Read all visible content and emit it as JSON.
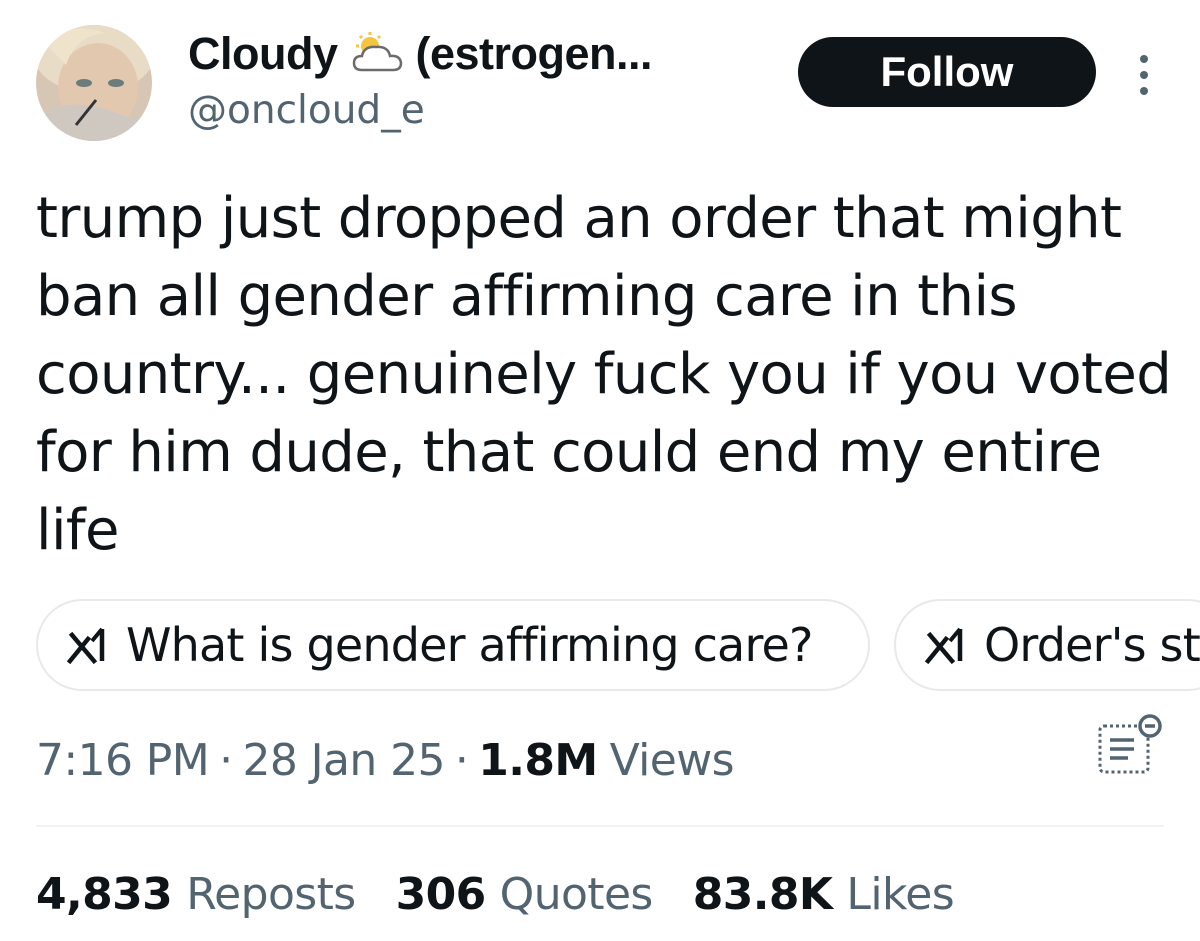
{
  "author": {
    "display_name": "Cloudy",
    "display_name_suffix": "(estrogen...",
    "handle": "@oncloud_e",
    "name_icon": "sun-behind-cloud-icon"
  },
  "actions": {
    "follow_label": "Follow",
    "more_icon": "more-vertical-icon"
  },
  "tweet": {
    "text": "trump just dropped an order that might\nban all gender affirming care in this\ncountry... genuinely fuck you if you voted\nfor him dude, that could end my entire\nlife"
  },
  "grok_prompts": [
    {
      "icon": "grok-icon",
      "label": "What is gender affirming care?"
    },
    {
      "icon": "grok-icon",
      "label": "Order's st"
    }
  ],
  "meta": {
    "time": "7:16 PM",
    "separator": "·",
    "date": "28 Jan 25",
    "views_count": "1.8M",
    "views_label": "Views",
    "analytics_icon": "analytics-icon"
  },
  "stats": [
    {
      "count": "4,833",
      "label": "Reposts"
    },
    {
      "count": "306",
      "label": "Quotes"
    },
    {
      "count": "83.8K",
      "label": "Likes"
    }
  ],
  "colors": {
    "text_primary": "#0f1419",
    "text_secondary": "#536471",
    "border": "#e7e9ea",
    "follow_bg": "#0f1419",
    "follow_text": "#ffffff"
  }
}
